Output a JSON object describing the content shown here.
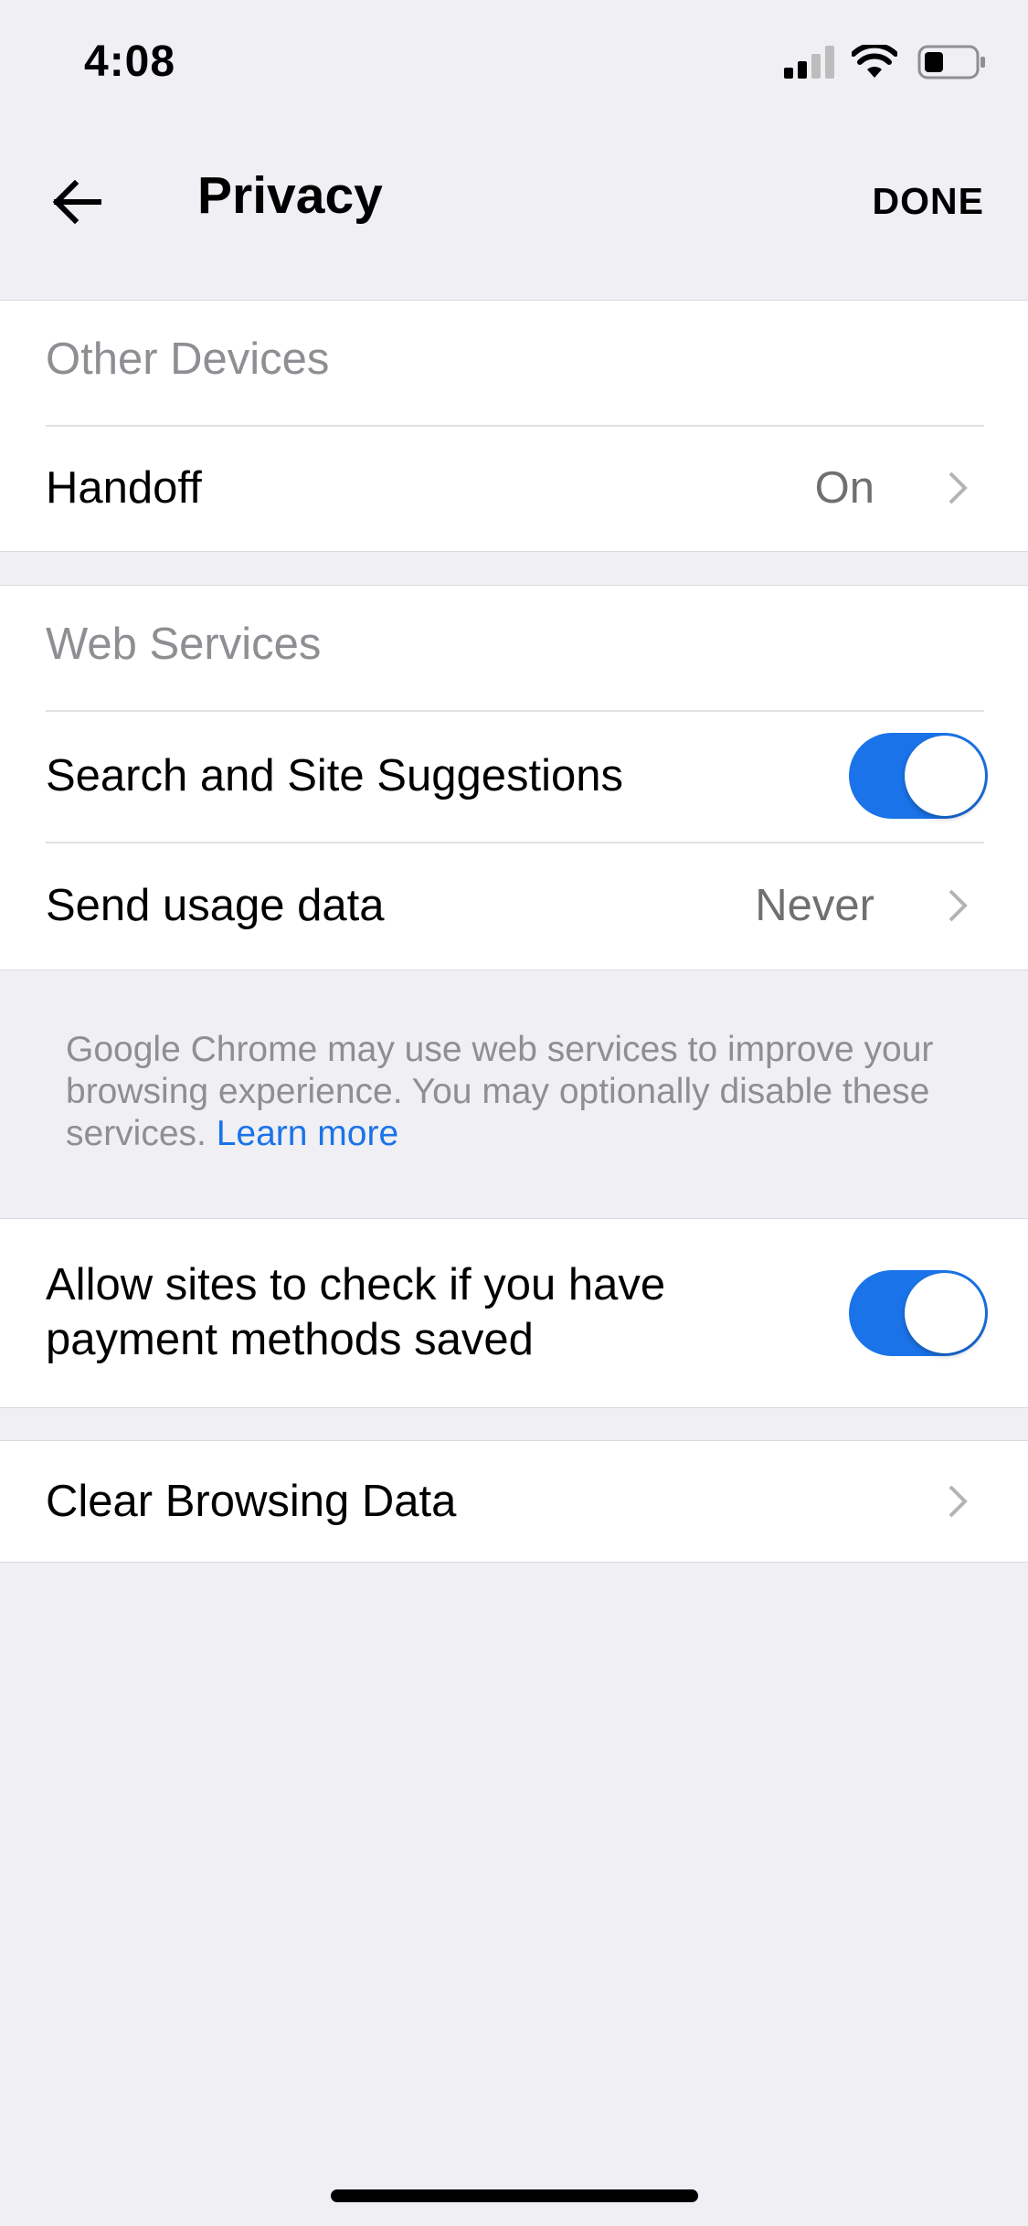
{
  "status_bar": {
    "time": "4:08",
    "icons": [
      "signal-icon",
      "wifi-icon",
      "battery-icon"
    ]
  },
  "nav": {
    "back_icon": "arrow-left-icon",
    "title": "Privacy",
    "done_label": "DONE"
  },
  "sections": {
    "other_devices": {
      "header": "Other Devices",
      "handoff_label": "Handoff",
      "handoff_value": "On"
    },
    "web_services": {
      "header": "Web Services",
      "suggestions_label": "Search and Site Suggestions",
      "suggestions_enabled": true,
      "usage_label": "Send usage data",
      "usage_value": "Never"
    },
    "footnote": {
      "text": "Google Chrome may use web services to improve your browsing experience. You may optionally disable these services. ",
      "link": "Learn more"
    },
    "payment": {
      "label": "Allow sites to check if you have payment methods saved",
      "enabled": true
    },
    "clear": {
      "label": "Clear Browsing Data"
    }
  },
  "colors": {
    "accent": "#1a73e8",
    "background": "#efeff4",
    "secondary_text": "#8e8e93"
  }
}
